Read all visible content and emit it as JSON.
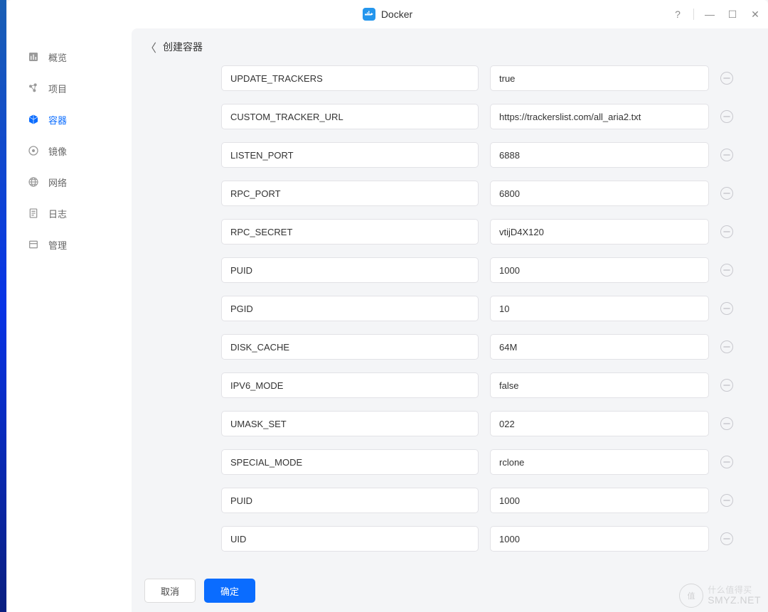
{
  "window": {
    "title": "Docker"
  },
  "sidebar": {
    "items": [
      {
        "label": "概览",
        "icon": "overview"
      },
      {
        "label": "项目",
        "icon": "project"
      },
      {
        "label": "容器",
        "icon": "container"
      },
      {
        "label": "镜像",
        "icon": "image"
      },
      {
        "label": "网络",
        "icon": "network"
      },
      {
        "label": "日志",
        "icon": "log"
      },
      {
        "label": "管理",
        "icon": "manage"
      }
    ],
    "activeIndex": 2
  },
  "page": {
    "title": "创建容器"
  },
  "env_rows": [
    {
      "key": "UPDATE_TRACKERS",
      "value": "true"
    },
    {
      "key": "CUSTOM_TRACKER_URL",
      "value": "https://trackerslist.com/all_aria2.txt"
    },
    {
      "key": "LISTEN_PORT",
      "value": "6888"
    },
    {
      "key": "RPC_PORT",
      "value": "6800"
    },
    {
      "key": "RPC_SECRET",
      "value": "vtijD4X120"
    },
    {
      "key": "PUID",
      "value": "1000"
    },
    {
      "key": "PGID",
      "value": "10"
    },
    {
      "key": "DISK_CACHE",
      "value": "64M"
    },
    {
      "key": "IPV6_MODE",
      "value": "false"
    },
    {
      "key": "UMASK_SET",
      "value": "022"
    },
    {
      "key": "SPECIAL_MODE",
      "value": "rclone"
    },
    {
      "key": "PUID",
      "value": "1000"
    },
    {
      "key": "UID",
      "value": "1000"
    }
  ],
  "footer": {
    "cancel": "取消",
    "confirm": "确定"
  },
  "watermark": {
    "badge": "值",
    "cn": "什么值得买",
    "text": "SMYZ.NET"
  }
}
